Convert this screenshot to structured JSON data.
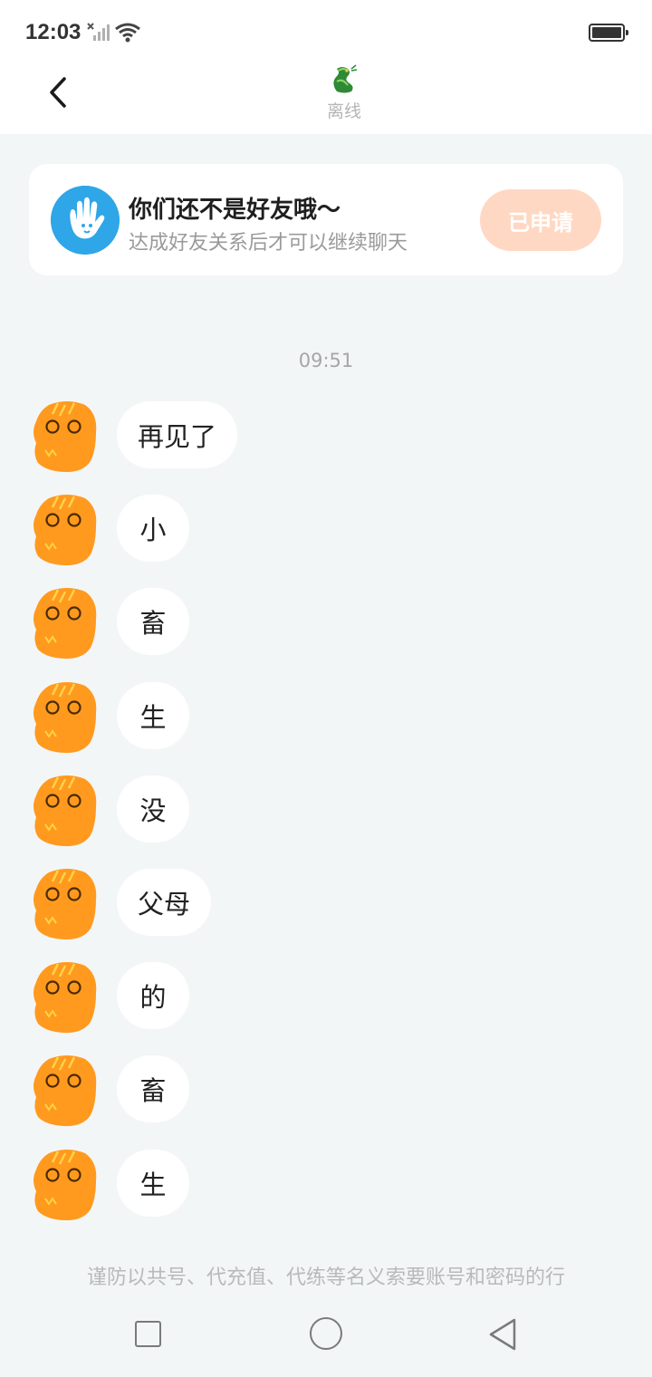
{
  "status_bar": {
    "time": "12:03",
    "icons": [
      "signal-off-icon",
      "wifi-icon",
      "battery-icon"
    ]
  },
  "header": {
    "back_icon": "chevron-left-icon",
    "contact_icon": "dragon-icon",
    "status": "离线"
  },
  "friend_card": {
    "avatar_icon": "waving-hand-icon",
    "title": "你们还不是好友哦～",
    "subtitle": "达成好友关系后才可以继续聊天",
    "button_label": "已申请",
    "button_color": "#ffd8c3"
  },
  "chat": {
    "timestamp": "09:51",
    "messages": [
      {
        "text": "再见了"
      },
      {
        "text": "小"
      },
      {
        "text": "畜"
      },
      {
        "text": "生"
      },
      {
        "text": "没"
      },
      {
        "text": "父母"
      },
      {
        "text": "的"
      },
      {
        "text": "畜"
      },
      {
        "text": "生"
      }
    ]
  },
  "warning": "谨防以共号、代充值、代练等名义索要账号和密码的行",
  "nav_bar": {
    "icons": [
      "recent-apps-icon",
      "home-icon",
      "back-triangle-icon"
    ]
  },
  "colors": {
    "background": "#f3f6f7",
    "accent_orange": "#ff9a1f",
    "hand_blue": "#2ea6e8"
  }
}
